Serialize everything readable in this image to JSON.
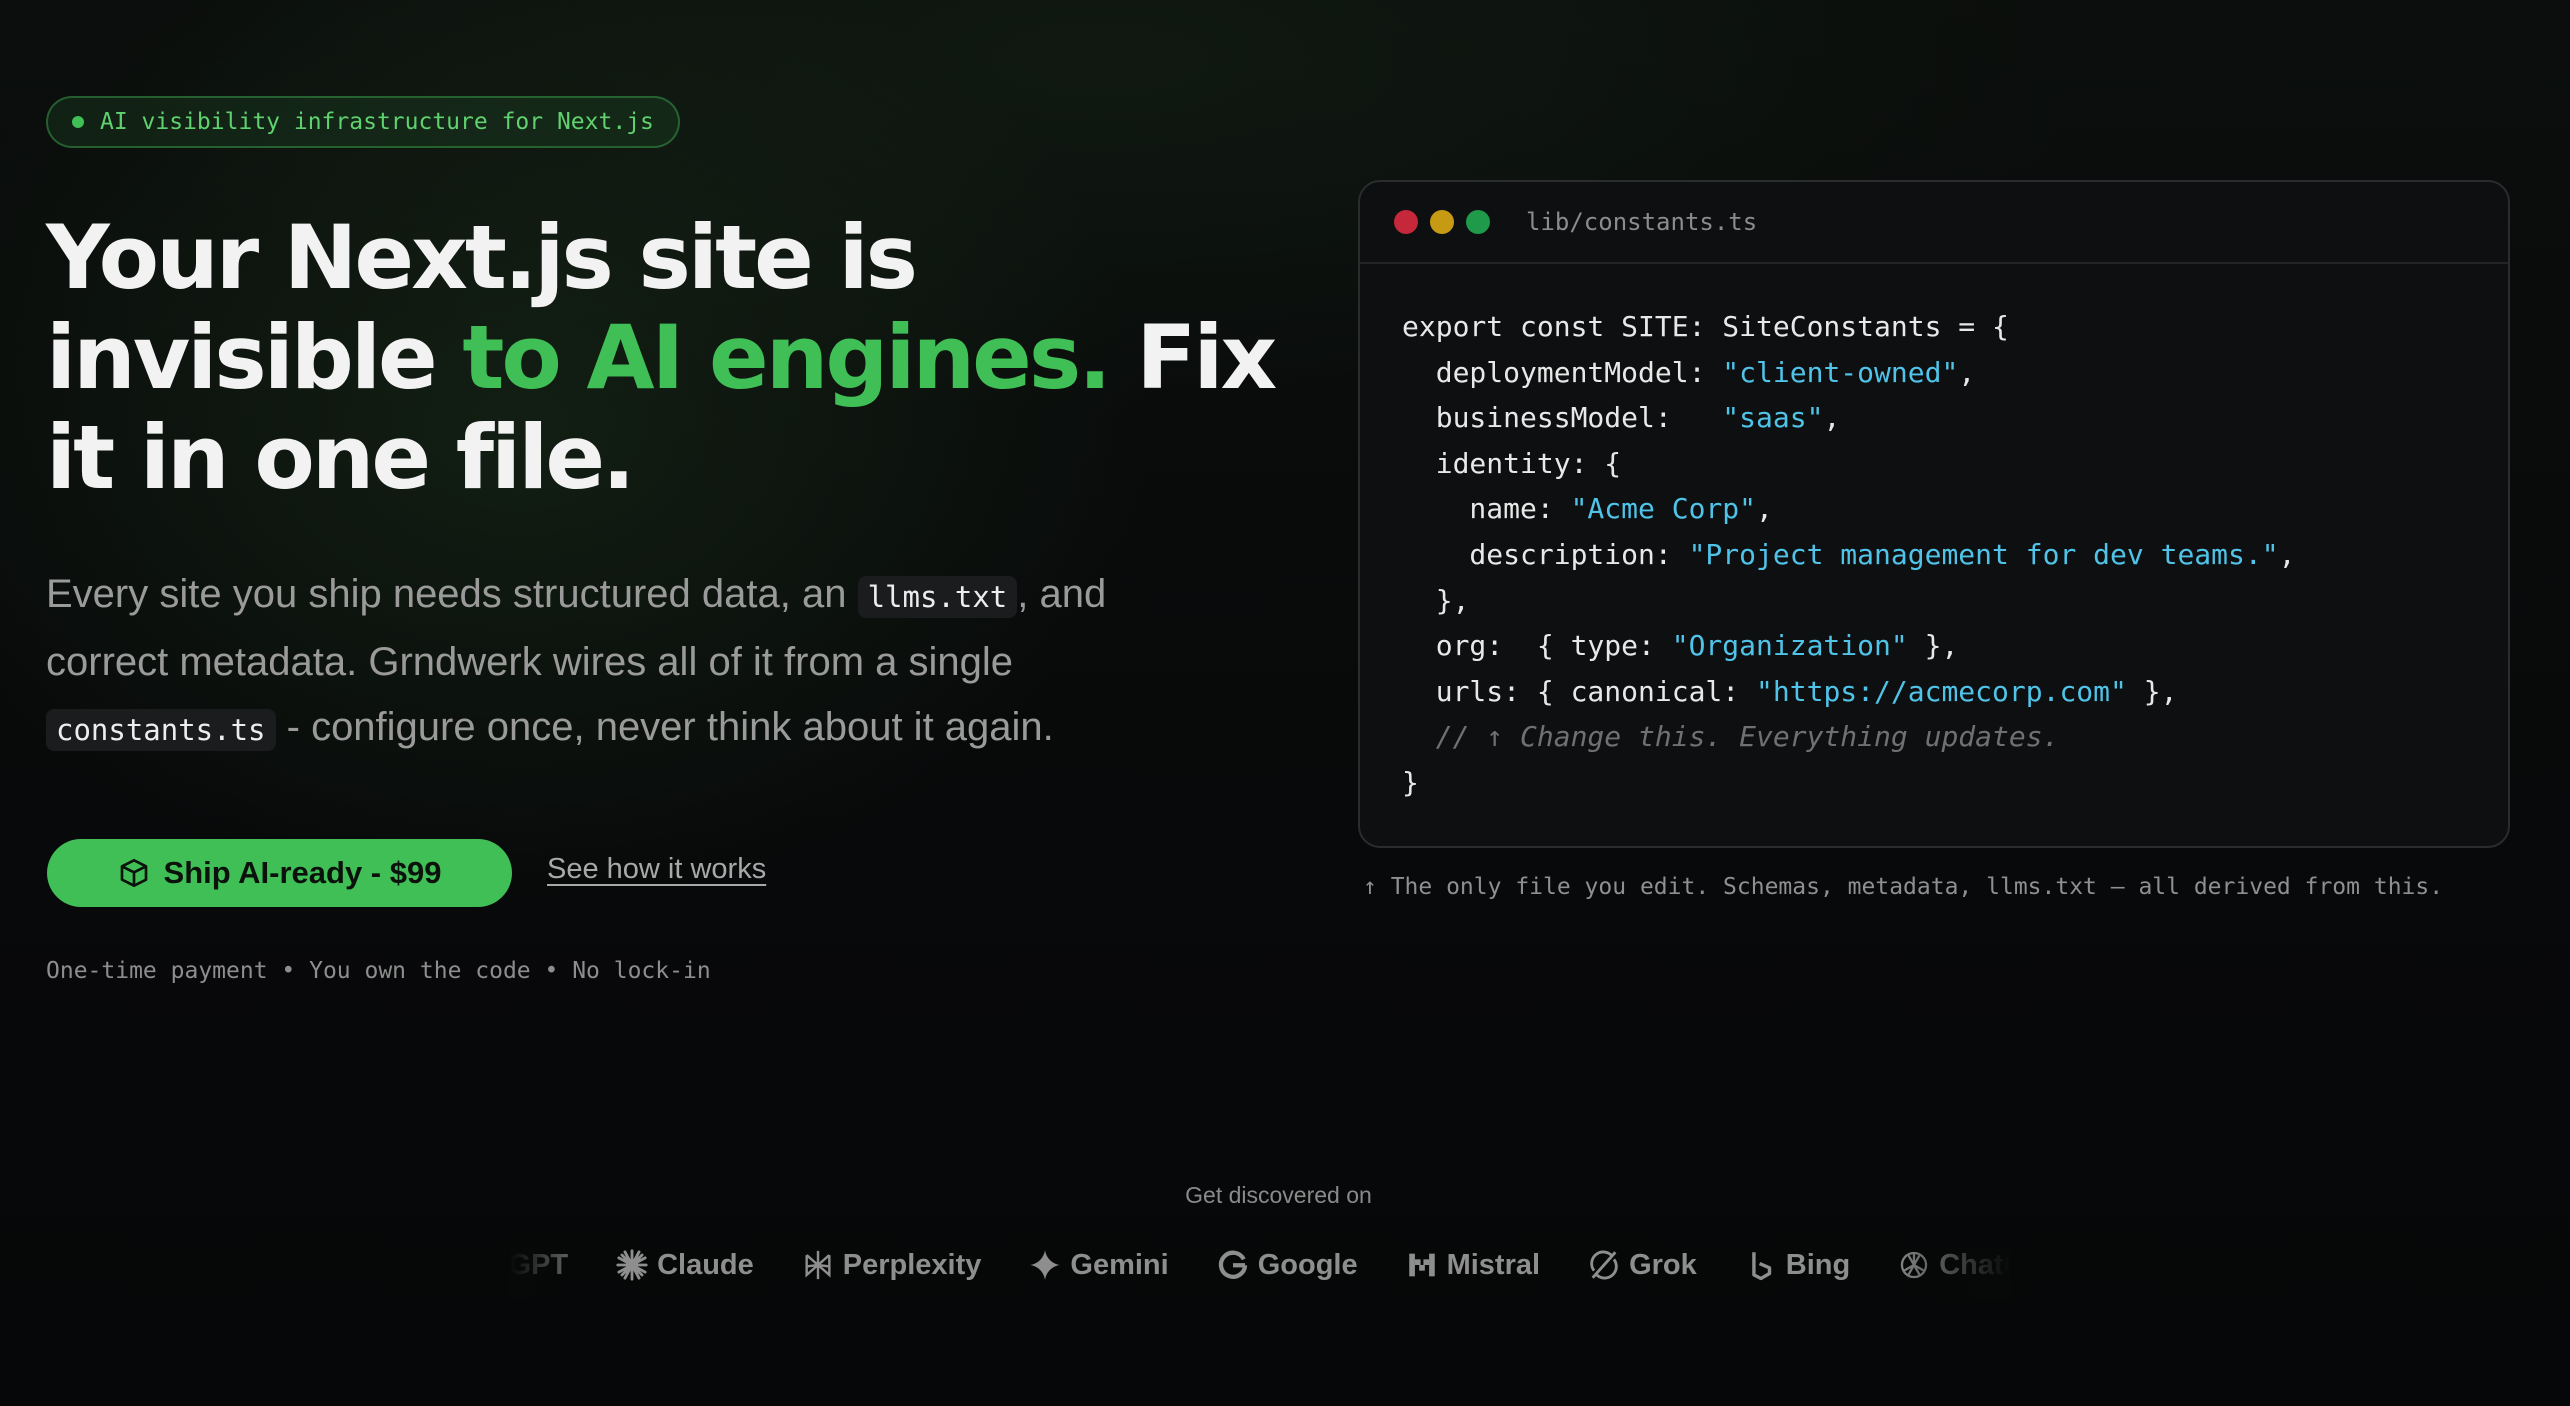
{
  "badge": {
    "text": "AI visibility infrastructure for Next.js"
  },
  "hero": {
    "headline_part1": "Your Next.js site is invisible ",
    "headline_accent": "to AI engines.",
    "headline_part2": " Fix it in one file.",
    "sub_part1": "Every site you ship needs structured data, an ",
    "sub_code1": "llms.txt",
    "sub_part2": ", and correct metadata. Grndwerk wires all of it from a single ",
    "sub_code2": "constants.ts",
    "sub_part3": " - configure once, never think about it again.",
    "cta_label": "Ship AI-ready - $99",
    "cta_icon": "box-icon",
    "secondary_link": "See how it works",
    "fine_print": "One-time payment • You own the code • No lock-in"
  },
  "code_window": {
    "filename": "lib/constants.ts",
    "colors": {
      "red": "#c5283a",
      "yellow": "#c79a14",
      "green": "#1e9a4a",
      "string": "#4fc3e8"
    },
    "lines": [
      [
        {
          "t": "export const SITE: SiteConstants = {"
        }
      ],
      [
        {
          "t": "  deploymentModel: "
        },
        {
          "t": "\"client-owned\"",
          "c": "str"
        },
        {
          "t": ","
        }
      ],
      [
        {
          "t": "  businessModel:   "
        },
        {
          "t": "\"saas\"",
          "c": "str"
        },
        {
          "t": ","
        }
      ],
      [
        {
          "t": "  identity: {"
        }
      ],
      [
        {
          "t": "    name: "
        },
        {
          "t": "\"Acme Corp\"",
          "c": "str"
        },
        {
          "t": ","
        }
      ],
      [
        {
          "t": "    description: "
        },
        {
          "t": "\"Project management for dev teams.\"",
          "c": "str"
        },
        {
          "t": ","
        }
      ],
      [
        {
          "t": "  },"
        }
      ],
      [
        {
          "t": "  org:  { type: "
        },
        {
          "t": "\"Organization\"",
          "c": "str"
        },
        {
          "t": " },"
        }
      ],
      [
        {
          "t": "  urls: { canonical: "
        },
        {
          "t": "\"https://acmecorp.com\"",
          "c": "str"
        },
        {
          "t": " },"
        }
      ],
      [
        {
          "t": "  // ↑ Change this. Everything updates.",
          "c": "cmt"
        }
      ],
      [
        {
          "t": "}"
        }
      ]
    ],
    "caption": "↑ The only file you edit. Schemas, metadata, llms.txt — all derived from this."
  },
  "discovered": {
    "heading": "Get discovered on",
    "platforms": [
      {
        "name": "ChatGPT",
        "icon": "chatgpt-icon"
      },
      {
        "name": "Claude",
        "icon": "claude-icon"
      },
      {
        "name": "Perplexity",
        "icon": "perplexity-icon"
      },
      {
        "name": "Gemini",
        "icon": "gemini-icon"
      },
      {
        "name": "Google",
        "icon": "google-icon"
      },
      {
        "name": "Mistral",
        "icon": "mistral-icon"
      },
      {
        "name": "Grok",
        "icon": "grok-icon"
      },
      {
        "name": "Bing",
        "icon": "bing-icon"
      },
      {
        "name": "ChatGPT",
        "icon": "chatgpt-icon"
      }
    ]
  }
}
